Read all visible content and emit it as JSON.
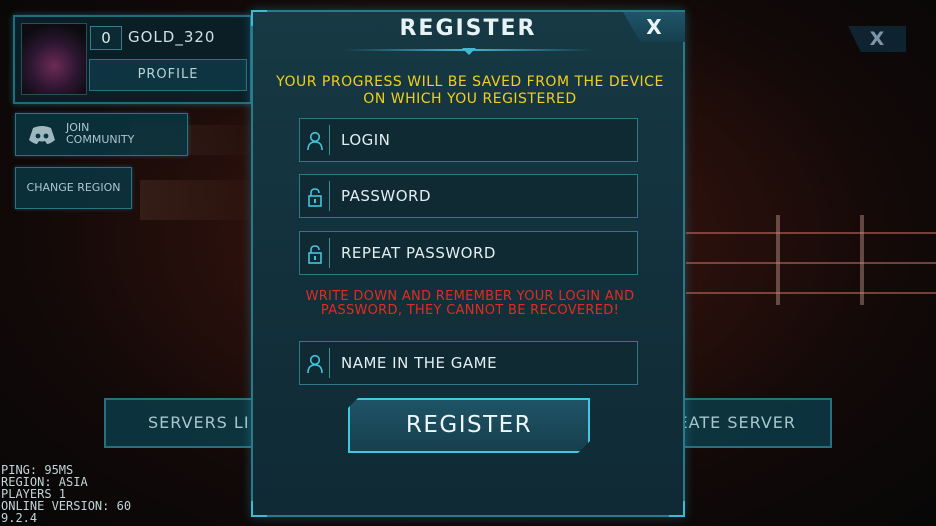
{
  "player": {
    "level": "0",
    "gold": "GOLD_320",
    "profile_label": "PROFILE"
  },
  "sidebar": {
    "join_community": "JOIN\nCOMMUNITY",
    "change_region": "CHANGE REGION"
  },
  "main_menu": {
    "close_label": "X",
    "servers_list_label": "SERVERS LI",
    "create_server_label": "EATE SERVER"
  },
  "stats": {
    "ping": "PING: 95MS",
    "region": "REGION: ASIA",
    "players": "PLAYERS 1",
    "online_version": "ONLINE VERSION: 60",
    "build": "9.2.4"
  },
  "register_dialog": {
    "title": "REGISTER",
    "close_label": "X",
    "progress_note": "YOUR PROGRESS WILL BE SAVED FROM THE DEVICE ON WHICH YOU REGISTERED",
    "login_placeholder": "LOGIN",
    "password_placeholder": "PASSWORD",
    "repeat_password_placeholder": "REPEAT PASSWORD",
    "warning": "WRITE DOWN AND REMEMBER YOUR LOGIN AND PASSWORD, THEY CANNOT BE RECOVERED!",
    "name_placeholder": "NAME IN THE GAME",
    "submit_label": "REGISTER"
  },
  "colors": {
    "accent": "#41c7e0",
    "notice": "#f3cf1c",
    "warning": "#e32b20",
    "panel": "#12303b"
  },
  "icons": {
    "login": "user-icon",
    "password": "lock-icon",
    "repeat_password": "lock-icon",
    "name": "user-icon",
    "community": "discord-icon"
  }
}
